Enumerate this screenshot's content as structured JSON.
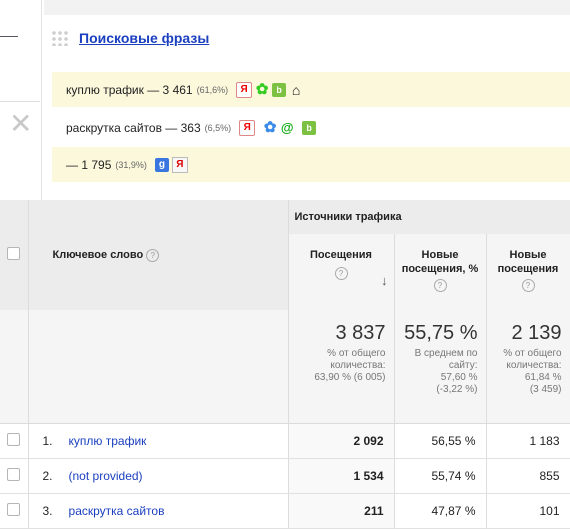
{
  "widget": {
    "title": "Поисковые фразы",
    "phrases": [
      {
        "text": "куплю трафик — 3 461",
        "pct": "(61,6%)"
      },
      {
        "text": "раскрутка сайтов — 363",
        "pct": "(6,5%)"
      },
      {
        "text": "— 1 795",
        "pct": "(31,9%)"
      }
    ]
  },
  "report": {
    "group_header": "Источники трафика",
    "keyword_header": "Ключевое слово",
    "col_visits": "Посещения",
    "col_new_visits_pct": "Новые посещения, %",
    "col_new_visits": "Новые посещения",
    "help_glyph": "?",
    "sort_glyph": "↓",
    "totals": {
      "visits": "3 837",
      "visits_sub1": "% от общего",
      "visits_sub2": "количества:",
      "visits_sub3": "63,90 % (6 005)",
      "newpct": "55,75 %",
      "newpct_sub1": "В среднем по",
      "newpct_sub2": "сайту:",
      "newpct_sub3": "57,60 %",
      "newpct_sub4": "(-3,22 %)",
      "newvisits": "2 139",
      "newvisits_sub1": "% от общего",
      "newvisits_sub2": "количества:",
      "newvisits_sub3": "61,84 %",
      "newvisits_sub4": "(3 459)"
    },
    "rows": [
      {
        "index": "1.",
        "keyword": "куплю трафик",
        "visits": "2 092",
        "newpct": "56,55 %",
        "newvisits": "1 183"
      },
      {
        "index": "2.",
        "keyword": "(not provided)",
        "visits": "1 534",
        "newpct": "55,74 %",
        "newvisits": "855"
      },
      {
        "index": "3.",
        "keyword": "раскрутка сайтов",
        "visits": "211",
        "newpct": "47,87 %",
        "newvisits": "101"
      }
    ]
  },
  "icons": {
    "yandex": "Я",
    "google": "g",
    "close": "✕",
    "flower": "✿",
    "house": "⌂",
    "mail": "@",
    "bing": "b"
  }
}
